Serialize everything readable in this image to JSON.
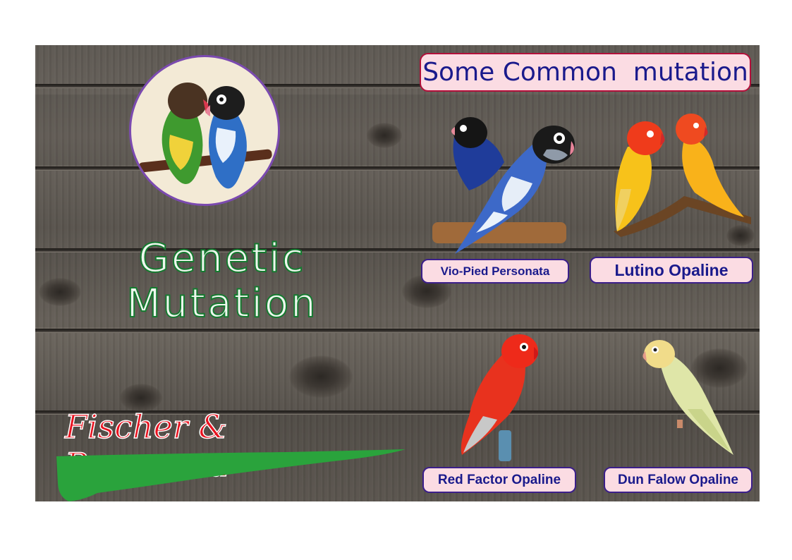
{
  "header": {
    "title": "Some Common  mutation"
  },
  "left_panel": {
    "heading_line1": "Genetic",
    "heading_line2": "Mutation",
    "subtitle": "Fischer & Personata"
  },
  "mutations": [
    {
      "label": "Vio-Pied Personata"
    },
    {
      "label": "Lutino Opaline"
    },
    {
      "label": "Red Factor Opaline"
    },
    {
      "label": "Dun Falow Opaline"
    }
  ],
  "colors": {
    "label_bg": "#fbdce3",
    "label_border": "#3b1f8a",
    "title_border": "#b2103a",
    "text_navy": "#1a1a8c",
    "heading_green": "#167a30",
    "subtitle_red": "#e8121f",
    "brush_green": "#2aa33c"
  }
}
